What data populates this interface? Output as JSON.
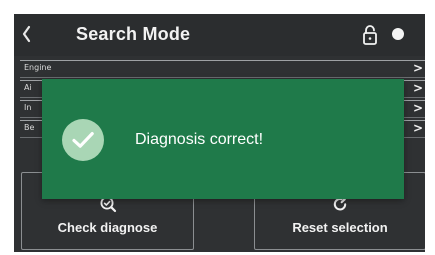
{
  "header": {
    "back_icon": "chevron-left-icon",
    "title": "Search Mode",
    "lock_icon": "unlocked-padlock-icon",
    "status_dot_icon": "status-dot-icon"
  },
  "list": {
    "items": [
      {
        "label": "Engine"
      },
      {
        "label": "Ai"
      },
      {
        "label": "In"
      },
      {
        "label": "Be"
      }
    ],
    "chevron": ">"
  },
  "toast": {
    "message": "Diagnosis correct!",
    "icon": "check-circle-icon",
    "background_color": "#1f7a4a",
    "circle_color": "#a9d6b5"
  },
  "buttons": {
    "check": {
      "label": "Check diagnose",
      "icon": "magnifier-check-icon"
    },
    "reset": {
      "label": "Reset selection",
      "icon": "reset-refresh-icon"
    }
  },
  "colors": {
    "screen_bg": "#2f3133",
    "text": "#f2f2f2",
    "divider": "#9ea1a4"
  }
}
